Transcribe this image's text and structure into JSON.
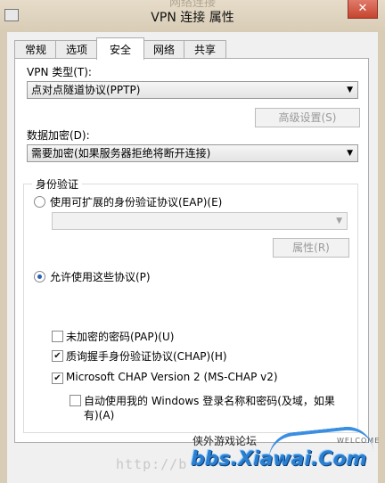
{
  "window": {
    "ghost_title": "网络连接",
    "title": "VPN 连接 属性",
    "close_glyph": "✕"
  },
  "tabs": [
    {
      "label": "常规",
      "active": false
    },
    {
      "label": "选项",
      "active": false
    },
    {
      "label": "安全",
      "active": true
    },
    {
      "label": "网络",
      "active": false
    },
    {
      "label": "共享",
      "active": false
    }
  ],
  "security": {
    "vpn_type_label": "VPN 类型(T):",
    "vpn_type_value": "点对点隧道协议(PPTP)",
    "advanced_button": "高级设置(S)",
    "encryption_label": "数据加密(D):",
    "encryption_value": "需要加密(如果服务器拒绝将断开连接)",
    "auth_group_title": "身份验证",
    "eap_radio_label": "使用可扩展的身份验证协议(EAP)(E)",
    "eap_combo_value": "",
    "properties_button": "属性(R)",
    "allow_protocols_label": "允许使用这些协议(P)",
    "protocols": [
      {
        "label": "未加密的密码(PAP)(U)",
        "checked": false
      },
      {
        "label": "质询握手身份验证协议(CHAP)(H)",
        "checked": true
      },
      {
        "label": "Microsoft CHAP Version 2 (MS-CHAP v2)",
        "checked": true
      }
    ],
    "autologon_line1": "自动使用我的 Windows 登录名称和密码(及域，如果",
    "autologon_line2": "有)(A)",
    "autologon_checked": false
  },
  "watermark": {
    "cn_text": "侠外游戏论坛",
    "welcome": "WELCOME",
    "url_text": "http://b",
    "logo_text": "bbs.Xiawai.Com"
  },
  "colors": {
    "accent": "#2a5fb8",
    "close_red": "#c6452f",
    "title_bar": "#d8ccb6"
  }
}
